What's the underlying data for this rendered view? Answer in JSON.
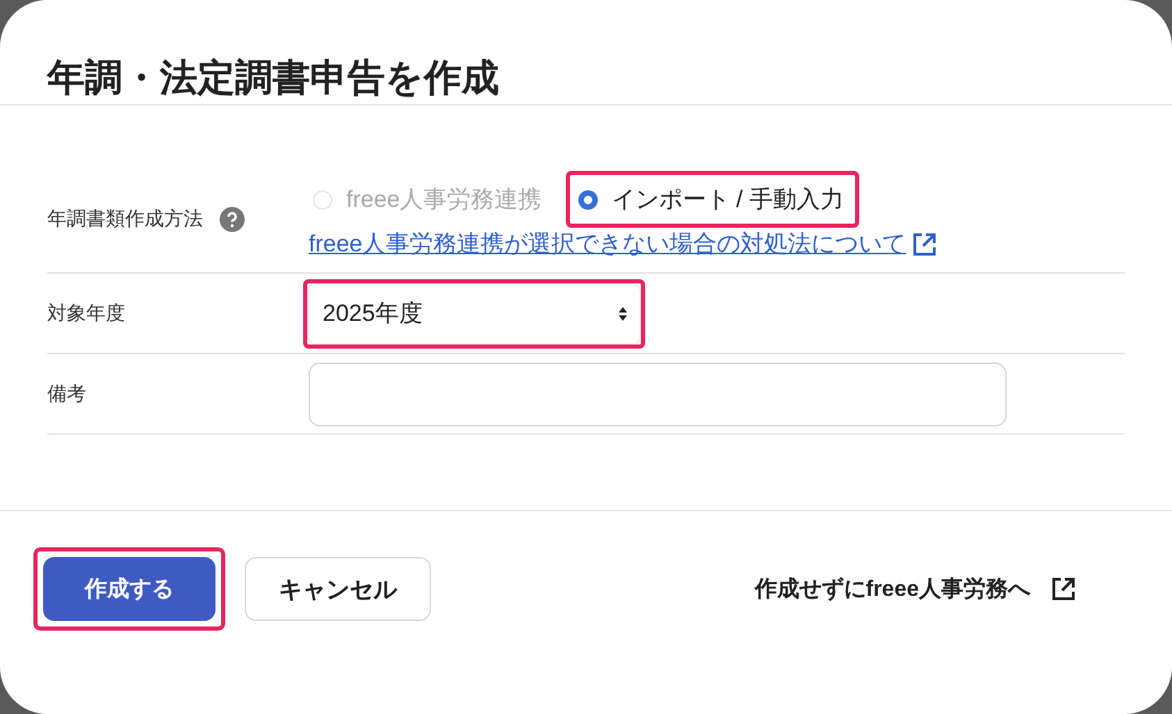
{
  "dialog": {
    "title": "年調・法定調書申告を作成"
  },
  "fields": [
    {
      "kind": "radio",
      "label": "年調書類作成方法",
      "help": true,
      "options": [
        {
          "label": "freee人事労務連携",
          "selected": false,
          "disabled": true,
          "highlighted": false
        },
        {
          "label": "インポート / 手動入力",
          "selected": true,
          "disabled": false,
          "highlighted": true
        }
      ],
      "link": "freee人事労務連携が選択できない場合の対処法について"
    },
    {
      "kind": "select",
      "label": "対象年度",
      "value": "2025年度",
      "highlighted": true
    },
    {
      "kind": "text",
      "label": "備考"
    }
  ],
  "footer": {
    "primary": {
      "label": "作成する",
      "highlighted": true
    },
    "secondary": {
      "label": "キャンセル"
    },
    "link": "作成せずにfreee人事労務へ"
  }
}
